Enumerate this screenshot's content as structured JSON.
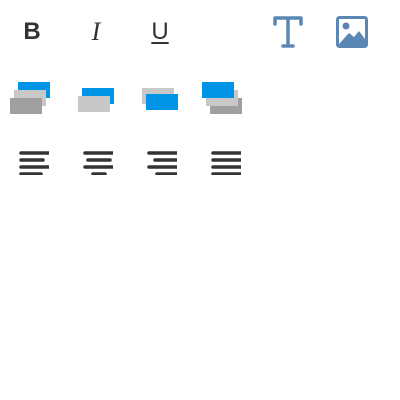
{
  "toolbar": {
    "text_format": {
      "bold_label": "B",
      "italic_label": "I",
      "underline_label": "U"
    },
    "insert": {
      "text_icon": "text-insert-icon",
      "image_icon": "image-insert-icon"
    },
    "arrange": {
      "icons": [
        "bring-to-front-icon",
        "bring-forward-icon",
        "send-backward-icon",
        "send-to-back-icon"
      ]
    },
    "align": {
      "icons": [
        "align-left-icon",
        "align-center-icon",
        "align-right-icon",
        "align-justify-icon"
      ]
    }
  },
  "colors": {
    "text_dark": "#333333",
    "accent_blue": "#0094e6",
    "light_gray": "#c8c8c8",
    "mid_gray": "#a0a0a0",
    "icon_blue": "#5b87b5"
  }
}
